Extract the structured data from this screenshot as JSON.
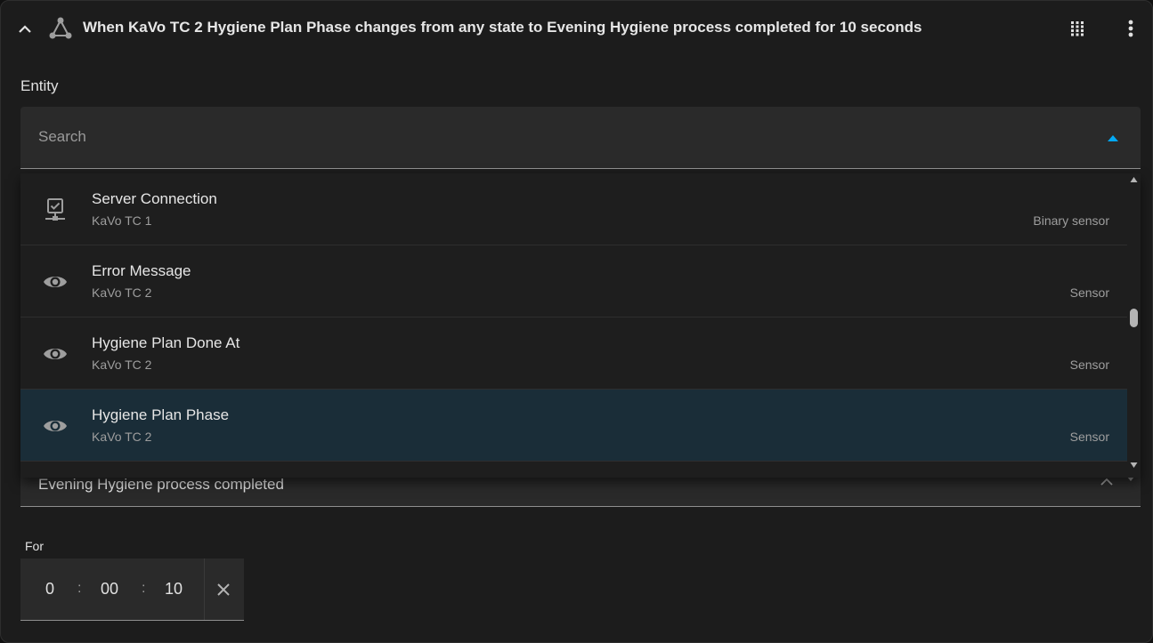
{
  "header": {
    "title": "When KaVo TC 2 Hygiene Plan Phase changes from any state to Evening Hygiene process completed for 10 seconds",
    "trigger_icon": "state-trigger-icon",
    "collapse_icon": "chevron-up-icon",
    "drag_icon": "drag-handle-icon",
    "menu_icon": "more-vert-icon"
  },
  "entity": {
    "label": "Entity",
    "search_placeholder": "Search",
    "search_value": ""
  },
  "dropdown": {
    "items": [
      {
        "name": "Server Connection",
        "device": "KaVo TC 1",
        "domain": "Binary sensor",
        "icon": "server-network-icon",
        "selected": false
      },
      {
        "name": "Error Message",
        "device": "KaVo TC 2",
        "domain": "Sensor",
        "icon": "eye-icon",
        "selected": false
      },
      {
        "name": "Hygiene Plan Done At",
        "device": "KaVo TC 2",
        "domain": "Sensor",
        "icon": "eye-icon",
        "selected": false
      },
      {
        "name": "Hygiene Plan Phase",
        "device": "KaVo TC 2",
        "domain": "Sensor",
        "icon": "eye-icon",
        "selected": true
      }
    ],
    "scroll_fraction": 0.47
  },
  "state": {
    "value": "Evening Hygiene process completed"
  },
  "duration": {
    "label": "For",
    "hours": "0",
    "minutes": "00",
    "seconds": "10",
    "separator": ":"
  },
  "colors": {
    "accent": "#03a9f4",
    "selected_row": "#1a2d38",
    "card": "#1c1c1c"
  }
}
